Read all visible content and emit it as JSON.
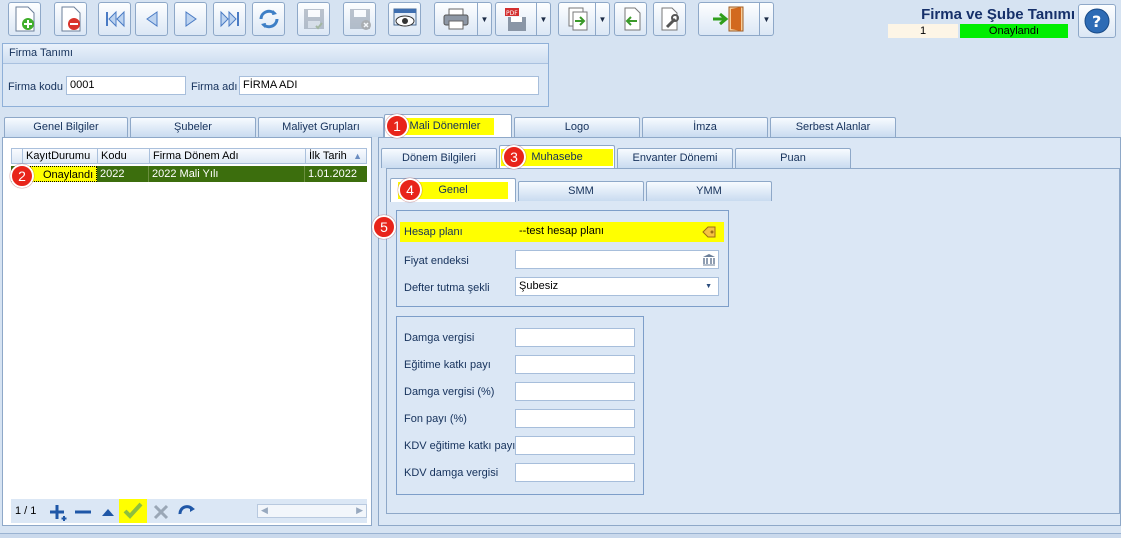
{
  "window": {
    "title": "Firma ve Şube Tanımı",
    "record_number": "1",
    "record_status": "Onaylandı"
  },
  "toolbar": {
    "icons": [
      "new-record-icon",
      "delete-record-icon",
      "first-record-icon",
      "previous-record-icon",
      "next-record-icon",
      "last-record-icon",
      "refresh-icon",
      "save-icon",
      "save-cancel-icon",
      "preview-icon",
      "print-icon",
      "pdf-icon",
      "export-icon",
      "import-icon",
      "settings-icon",
      "exit-door-icon",
      "help-icon"
    ]
  },
  "firma": {
    "group_title": "Firma Tanımı",
    "code_label": "Firma kodu",
    "code_value": "0001",
    "name_label": "Firma adı",
    "name_value": "FİRMA ADI"
  },
  "main_tabs": [
    "Genel Bilgiler",
    "Şubeler",
    "Maliyet Grupları",
    "Mali Dönemler",
    "Logo",
    "İmza",
    "Serbest Alanlar"
  ],
  "grid": {
    "columns": [
      "KayıtDurumu",
      "Kodu",
      "Firma Dönem Adı",
      "İlk Tarih"
    ],
    "rows": [
      [
        "Onaylandı",
        "2022",
        "2022 Mali Yılı",
        "1.01.2022"
      ]
    ],
    "pager": "1 / 1"
  },
  "sub_tabs": [
    "Dönem Bilgileri",
    "Muhasebe",
    "Envanter Dönemi",
    "Puan"
  ],
  "inner_tabs": [
    "Genel",
    "SMM",
    "YMM"
  ],
  "accounting": {
    "hesap_plani_label": "Hesap planı",
    "hesap_plani_value": "--test hesap planı",
    "fiyat_endeksi_label": "Fiyat endeksi",
    "fiyat_endeksi_value": "",
    "defter_label": "Defter tutma şekli",
    "defter_value": "Şubesiz"
  },
  "taxes": {
    "labels": [
      "Damga vergisi",
      "Eğitime katkı payı",
      "Damga vergisi (%)",
      "Fon payı (%)",
      "KDV eğitime katkı payı",
      "KDV damga vergisi"
    ],
    "values": [
      "",
      "",
      "",
      "",
      "",
      ""
    ]
  },
  "badges": [
    "1",
    "2",
    "3",
    "4",
    "5"
  ],
  "colors": {
    "highlight": "#ffff00",
    "status_green": "#00ee00",
    "badge_red": "#e8241a",
    "row_selected": "#3c6e0d"
  }
}
